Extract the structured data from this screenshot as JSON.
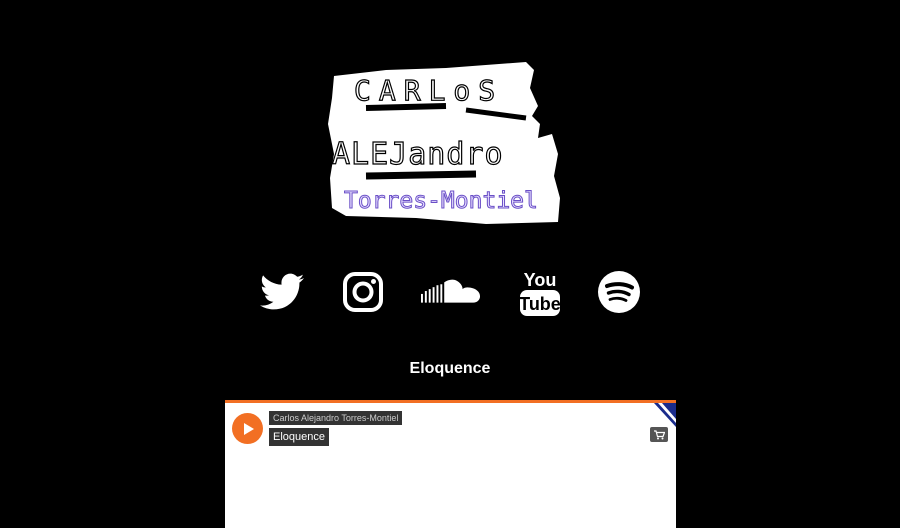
{
  "logo": {
    "line1": "CARLoS",
    "line2": "ALEJandro",
    "line3": "Torres-Montiel"
  },
  "social": [
    {
      "name": "twitter-icon"
    },
    {
      "name": "instagram-icon"
    },
    {
      "name": "soundcloud-icon"
    },
    {
      "name": "youtube-icon",
      "text_top": "You",
      "text_bottom": "Tube"
    },
    {
      "name": "spotify-icon"
    }
  ],
  "track_title": "Eloquence",
  "player": {
    "artist": "Carlos Alejandro Torres-Montiel",
    "track": "Eloquence",
    "accent_color": "#f26f23"
  }
}
